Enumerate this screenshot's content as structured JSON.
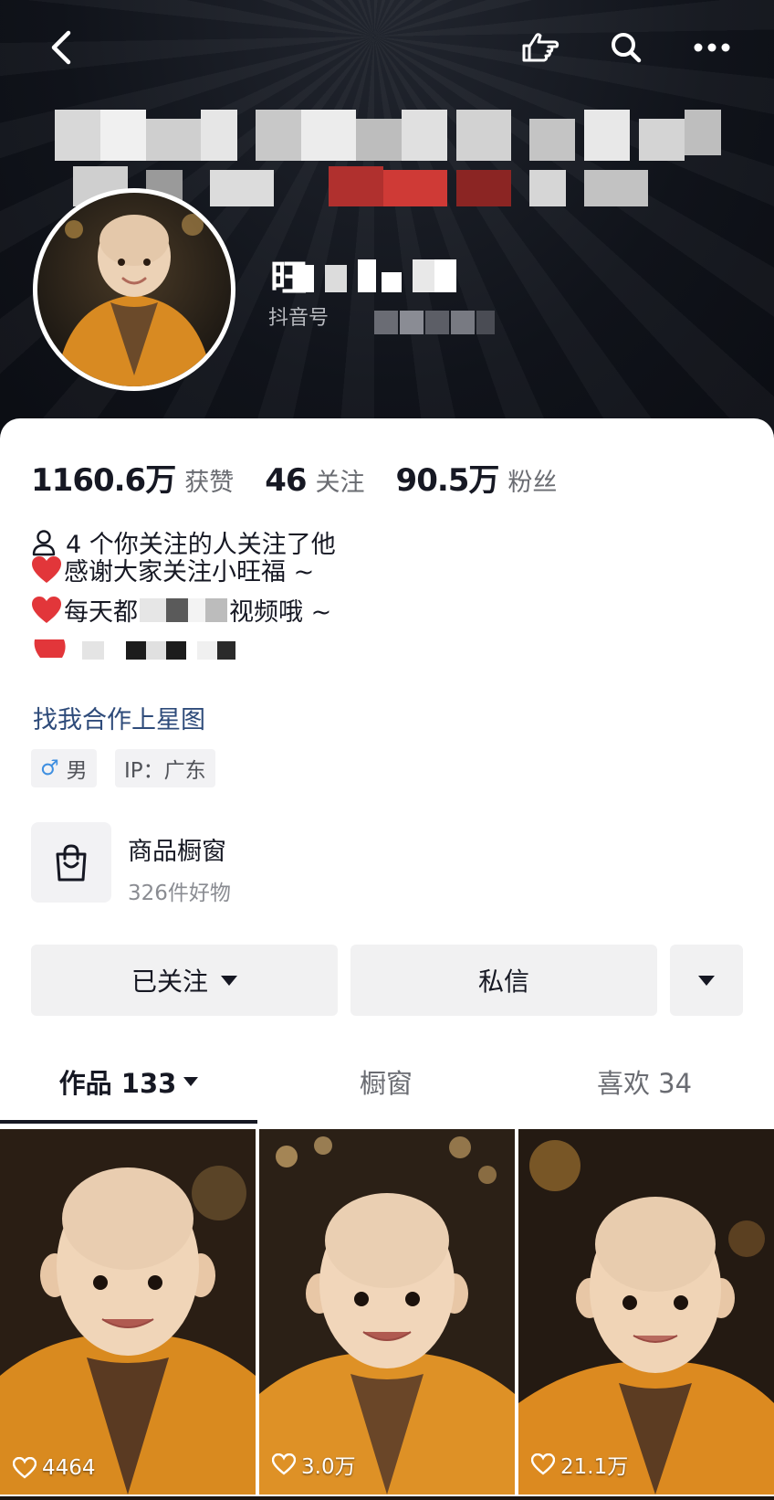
{
  "nav": {
    "back_icon": "chevron-left-icon",
    "share_icon": "pointing-hand-icon",
    "search_icon": "search-icon",
    "more_icon": "more-dots-icon"
  },
  "profile": {
    "nickname_visible_char": "旺",
    "platform_label": "抖音号"
  },
  "stats": [
    {
      "value": "1160.6万",
      "label": "获赞"
    },
    {
      "value": "46",
      "label": "关注"
    },
    {
      "value": "90.5万",
      "label": "粉丝"
    }
  ],
  "mutual_text": "4 个你关注的人关注了他",
  "bio": {
    "line1": "感谢大家关注小旺福 ~",
    "line2_start": "每天都",
    "line2_end": "视频哦 ~"
  },
  "star_link": "找我合作上星图",
  "tags": {
    "gender": "男",
    "ip": "IP：广东"
  },
  "shop": {
    "title": "商品橱窗",
    "subtitle": "326件好物"
  },
  "buttons": {
    "follow": "已关注",
    "message": "私信"
  },
  "tabs": {
    "works": "作品 133",
    "shop": "橱窗",
    "likes": "喜欢 34"
  },
  "videos": [
    {
      "likes": "4464"
    },
    {
      "likes": "3.0万"
    },
    {
      "likes": "21.1万"
    }
  ],
  "colors": {
    "header_bg": "#10131a",
    "link": "#2e4b7a",
    "male": "#3f8fe0",
    "robe": "#d88a22"
  }
}
